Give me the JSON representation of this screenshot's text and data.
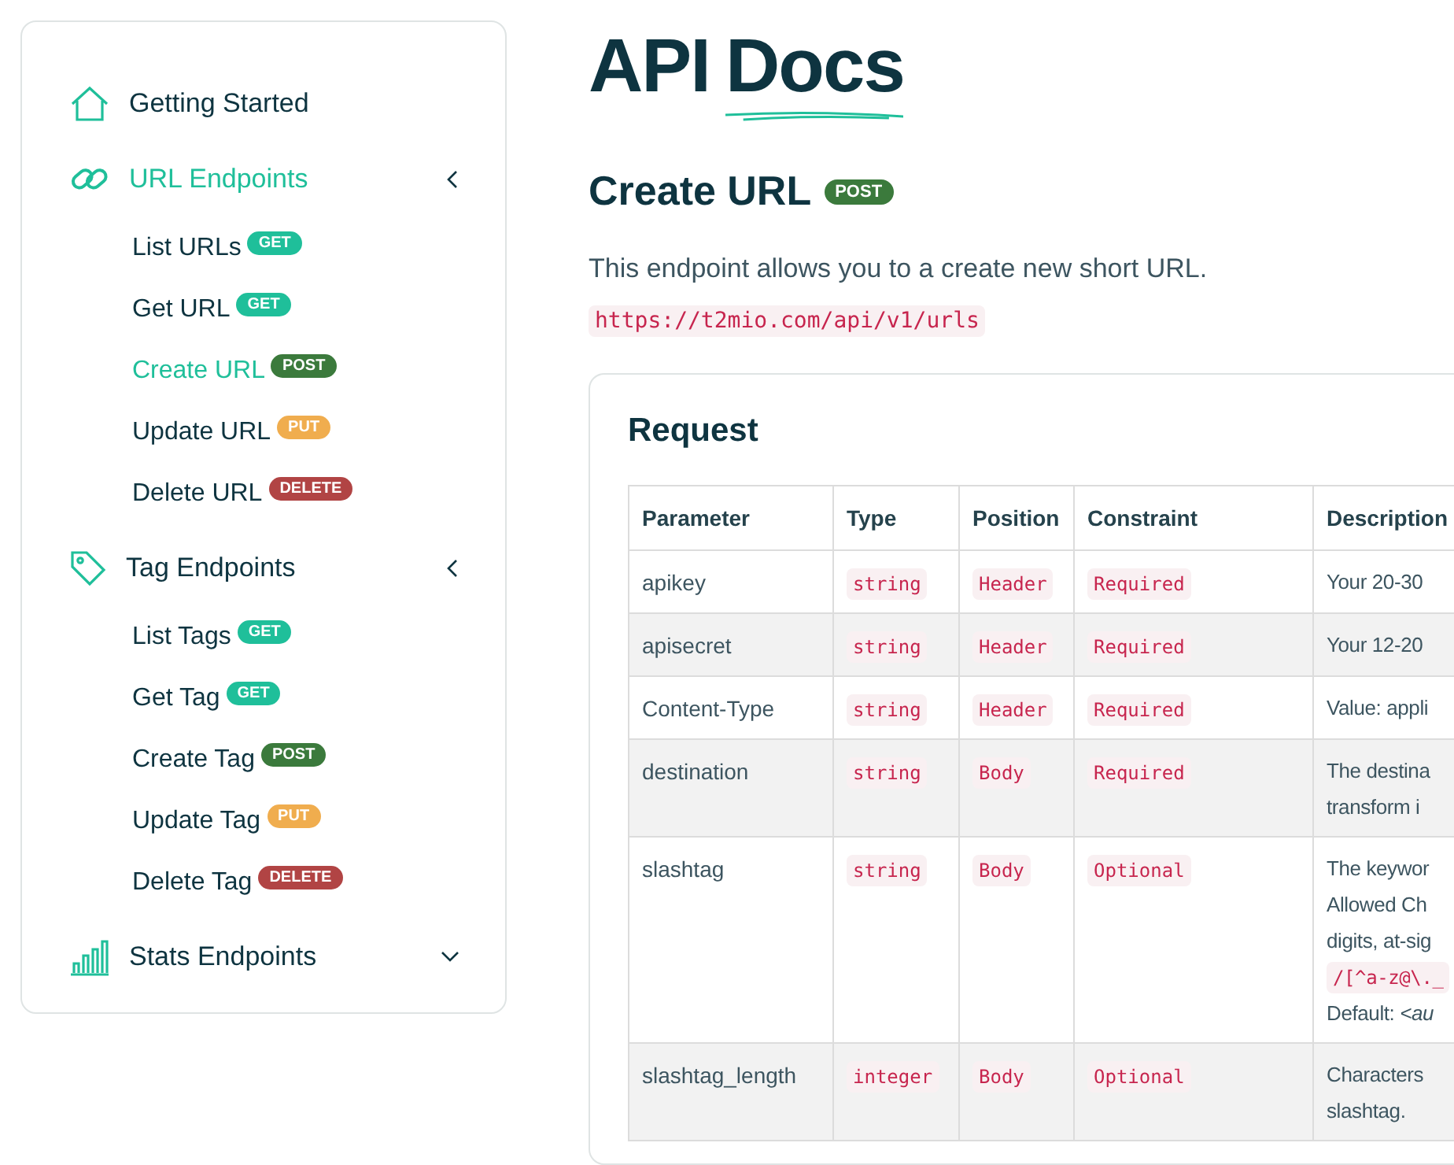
{
  "sidebar": {
    "sections": [
      {
        "label": "Getting Started",
        "selected": false
      },
      {
        "label": "URL Endpoints",
        "selected": true,
        "expanded": true,
        "items": [
          {
            "label": "List URLs",
            "method": "GET",
            "selected": false
          },
          {
            "label": "Get URL",
            "method": "GET",
            "selected": false
          },
          {
            "label": "Create URL",
            "method": "POST",
            "selected": true
          },
          {
            "label": "Update URL",
            "method": "PUT",
            "selected": false
          },
          {
            "label": "Delete URL",
            "method": "DELETE",
            "selected": false
          }
        ]
      },
      {
        "label": "Tag Endpoints",
        "selected": false,
        "expanded": true,
        "items": [
          {
            "label": "List Tags",
            "method": "GET",
            "selected": false
          },
          {
            "label": "Get Tag",
            "method": "GET",
            "selected": false
          },
          {
            "label": "Create Tag",
            "method": "POST",
            "selected": false
          },
          {
            "label": "Update Tag",
            "method": "PUT",
            "selected": false
          },
          {
            "label": "Delete Tag",
            "method": "DELETE",
            "selected": false
          }
        ]
      },
      {
        "label": "Stats Endpoints",
        "selected": false,
        "expanded": false
      }
    ]
  },
  "page": {
    "title_words": [
      "API",
      "Docs"
    ],
    "heading": "Create URL",
    "method": "POST",
    "description": "This endpoint allows you to a create new short URL.",
    "endpoint": "https://t2mio.com/api/v1/urls"
  },
  "request": {
    "title": "Request",
    "columns": [
      "Parameter",
      "Type",
      "Position",
      "Constraint",
      "Description"
    ],
    "rows": [
      {
        "parameter": "apikey",
        "type": "string",
        "position": "Header",
        "constraint": "Required",
        "description": [
          {
            "kind": "text",
            "text": "Your 20-30"
          }
        ]
      },
      {
        "parameter": "apisecret",
        "type": "string",
        "position": "Header",
        "constraint": "Required",
        "description": [
          {
            "kind": "text",
            "text": "Your 12-20"
          }
        ]
      },
      {
        "parameter": "Content-Type",
        "type": "string",
        "position": "Header",
        "constraint": "Required",
        "description": [
          {
            "kind": "text",
            "text": "Value: appli"
          }
        ]
      },
      {
        "parameter": "destination",
        "type": "string",
        "position": "Body",
        "constraint": "Required",
        "description": [
          {
            "kind": "text",
            "text": "The destina"
          },
          {
            "kind": "text",
            "text": "transform i"
          }
        ]
      },
      {
        "parameter": "slashtag",
        "type": "string",
        "position": "Body",
        "constraint": "Optional",
        "description": [
          {
            "kind": "text",
            "text": "The keywor"
          },
          {
            "kind": "text",
            "text": "Allowed Ch"
          },
          {
            "kind": "text",
            "text": "digits, at-sig"
          },
          {
            "kind": "code",
            "text": "/[^a-z@\\._"
          },
          {
            "kind": "text",
            "text": "Default: *<au*"
          }
        ]
      },
      {
        "parameter": "slashtag_length",
        "type": "integer",
        "position": "Body",
        "constraint": "Optional",
        "description": [
          {
            "kind": "text",
            "text": "Characters"
          },
          {
            "kind": "text",
            "text": "slashtag."
          }
        ]
      }
    ]
  }
}
